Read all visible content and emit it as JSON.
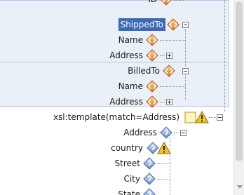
{
  "tree": {
    "id_label": "ID",
    "shipped_to": "ShippedTo",
    "shipped_name": "Name",
    "shipped_address": "Address",
    "billed_to": "BilledTo",
    "billed_name": "Name",
    "billed_address": "Address",
    "template": "xsl:template(match=Address)",
    "t_address": "Address",
    "t_country": "country",
    "t_street": "Street",
    "t_city": "City",
    "t_state": "State"
  },
  "colors": {
    "selection": "#3c68b6",
    "band": "#eaf0f8",
    "element_icon": "#e8913a",
    "warning": "#f5c518"
  },
  "icons": {
    "element": "element-diamond-icon",
    "attribute_ref": "attribute-diamond-icon",
    "warning": "warning-icon",
    "template": "template-icon"
  }
}
